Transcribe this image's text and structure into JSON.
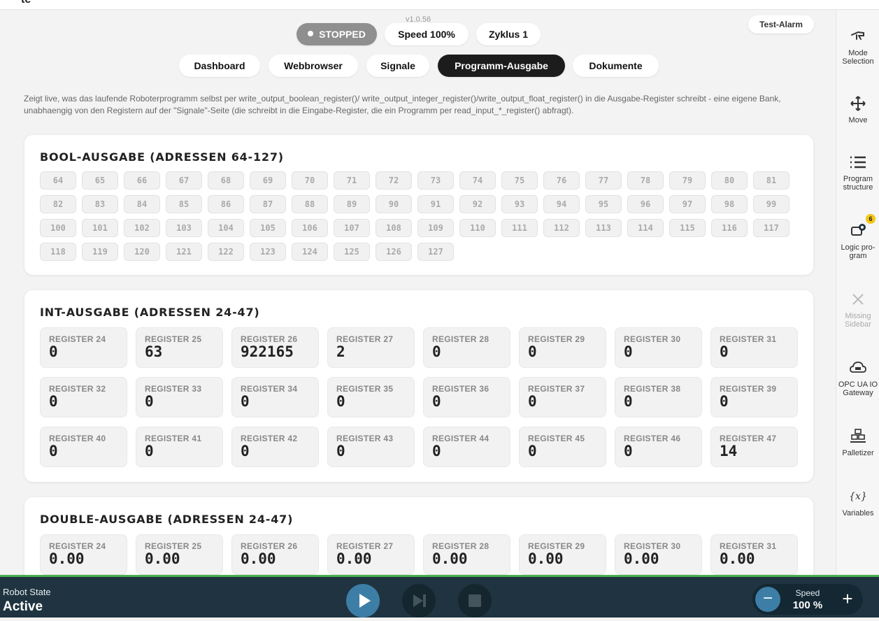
{
  "app": {
    "version": "v1.0.56",
    "logo": "te"
  },
  "status": {
    "state": "STOPPED",
    "speed": "Speed 100%",
    "cycle": "Zyklus 1"
  },
  "test_alarm": "Test-Alarm",
  "tabs": [
    "Dashboard",
    "Webbrowser",
    "Signale",
    "Programm-Ausgabe",
    "Dokumente"
  ],
  "active_tab": "Programm-Ausgabe",
  "description": "Zeigt live, was das laufende Roboterprogramm selbst per write_output_boolean_register()/ write_output_integer_register()/write_output_float_register() in die Ausgabe-Register schreibt - eine eigene Bank, unabhaengig von den Registern auf der \"Signale\"-Seite (die schreibt in die Eingabe-Register, die ein Programm per read_input_*_register() abfragt).",
  "bool_section": {
    "title": "BOOL-AUSGABE (ADRESSEN 64-127)",
    "registers": [
      "64",
      "65",
      "66",
      "67",
      "68",
      "69",
      "70",
      "71",
      "72",
      "73",
      "74",
      "75",
      "76",
      "77",
      "78",
      "79",
      "80",
      "81",
      "82",
      "83",
      "84",
      "85",
      "86",
      "87",
      "88",
      "89",
      "90",
      "91",
      "92",
      "93",
      "94",
      "95",
      "96",
      "97",
      "98",
      "99",
      "100",
      "101",
      "102",
      "103",
      "104",
      "105",
      "106",
      "107",
      "108",
      "109",
      "110",
      "111",
      "112",
      "113",
      "114",
      "115",
      "116",
      "117",
      "118",
      "119",
      "120",
      "121",
      "122",
      "123",
      "124",
      "125",
      "126",
      "127"
    ]
  },
  "int_section": {
    "title": "INT-AUSGABE (ADRESSEN 24-47)",
    "registers": [
      {
        "label": "REGISTER 24",
        "value": "0"
      },
      {
        "label": "REGISTER 25",
        "value": "63"
      },
      {
        "label": "REGISTER 26",
        "value": "922165"
      },
      {
        "label": "REGISTER 27",
        "value": "2"
      },
      {
        "label": "REGISTER 28",
        "value": "0"
      },
      {
        "label": "REGISTER 29",
        "value": "0"
      },
      {
        "label": "REGISTER 30",
        "value": "0"
      },
      {
        "label": "REGISTER 31",
        "value": "0"
      },
      {
        "label": "REGISTER 32",
        "value": "0"
      },
      {
        "label": "REGISTER 33",
        "value": "0"
      },
      {
        "label": "REGISTER 34",
        "value": "0"
      },
      {
        "label": "REGISTER 35",
        "value": "0"
      },
      {
        "label": "REGISTER 36",
        "value": "0"
      },
      {
        "label": "REGISTER 37",
        "value": "0"
      },
      {
        "label": "REGISTER 38",
        "value": "0"
      },
      {
        "label": "REGISTER 39",
        "value": "0"
      },
      {
        "label": "REGISTER 40",
        "value": "0"
      },
      {
        "label": "REGISTER 41",
        "value": "0"
      },
      {
        "label": "REGISTER 42",
        "value": "0"
      },
      {
        "label": "REGISTER 43",
        "value": "0"
      },
      {
        "label": "REGISTER 44",
        "value": "0"
      },
      {
        "label": "REGISTER 45",
        "value": "0"
      },
      {
        "label": "REGISTER 46",
        "value": "0"
      },
      {
        "label": "REGISTER 47",
        "value": "14"
      }
    ]
  },
  "double_section": {
    "title": "DOUBLE-AUSGABE (ADRESSEN 24-47)",
    "registers": [
      {
        "label": "REGISTER 24",
        "value": "0.00"
      },
      {
        "label": "REGISTER 25",
        "value": "0.00"
      },
      {
        "label": "REGISTER 26",
        "value": "0.00"
      },
      {
        "label": "REGISTER 27",
        "value": "0.00"
      },
      {
        "label": "REGISTER 28",
        "value": "0.00"
      },
      {
        "label": "REGISTER 29",
        "value": "0.00"
      },
      {
        "label": "REGISTER 30",
        "value": "0.00"
      },
      {
        "label": "REGISTER 31",
        "value": "0.00"
      }
    ]
  },
  "sidebar": {
    "items": [
      {
        "label": "Mode Selection",
        "icon": "hand-icon"
      },
      {
        "label": "Move",
        "icon": "move-arrows-icon"
      },
      {
        "label": "Program structure",
        "icon": "list-icon"
      },
      {
        "label": "Logic pro-gram",
        "icon": "logic-program-icon",
        "badge": "6"
      },
      {
        "label": "Missing Sidebar",
        "icon": "close-icon",
        "disabled": true
      },
      {
        "label": "OPC UA IO Gateway",
        "icon": "cloud-icon"
      },
      {
        "label": "Palletizer",
        "icon": "palletizer-icon"
      },
      {
        "label": "Variables",
        "icon": "variables-icon"
      }
    ]
  },
  "bottom": {
    "robot_state_label": "Robot State",
    "robot_state_value": "Active",
    "speed_label": "Speed",
    "speed_value": "100 %"
  },
  "colors": {
    "bottom_bar": "#1f3440",
    "status_line": "#4caf50",
    "play_button": "#3d7ea6",
    "active_tab": "#1c1c1c",
    "badge": "#f5c518"
  }
}
